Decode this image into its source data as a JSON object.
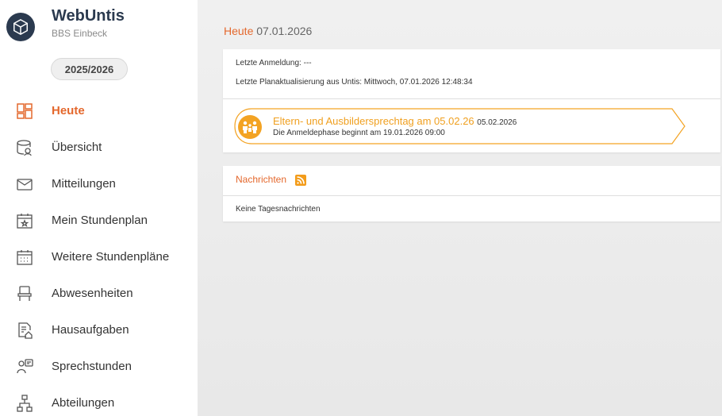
{
  "app": {
    "name": "WebUntis",
    "school": "BBS Einbeck",
    "school_year": "2025/2026"
  },
  "nav": [
    {
      "label": "Heute",
      "icon": "dashboard-icon",
      "active": true
    },
    {
      "label": "Übersicht",
      "icon": "overview-icon",
      "active": false
    },
    {
      "label": "Mitteilungen",
      "icon": "mail-icon",
      "active": false
    },
    {
      "label": "Mein Stundenplan",
      "icon": "my-timetable-icon",
      "active": false
    },
    {
      "label": "Weitere Stundenpläne",
      "icon": "timetables-icon",
      "active": false
    },
    {
      "label": "Abwesenheiten",
      "icon": "absence-icon",
      "active": false
    },
    {
      "label": "Hausaufgaben",
      "icon": "homework-icon",
      "active": false
    },
    {
      "label": "Sprechstunden",
      "icon": "office-hours-icon",
      "active": false
    },
    {
      "label": "Abteilungen",
      "icon": "departments-icon",
      "active": false
    }
  ],
  "header": {
    "title": "Heute",
    "date": "07.01.2026"
  },
  "info": {
    "last_login": "Letzte Anmeldung: ---",
    "last_update": "Letzte Planaktualisierung aus Untis: Mittwoch, 07.01.2026 12:48:34"
  },
  "event": {
    "title": "Eltern- und Ausbildersprechtag am 05.02.26",
    "date": "05.02.2026",
    "subtitle": "Die Anmeldephase beginnt am 19.01.2026 09:00"
  },
  "news": {
    "title": "Nachrichten",
    "empty": "Keine Tagesnachrichten"
  },
  "colors": {
    "accent": "#e4682d",
    "event": "#f3a323",
    "logo_bg": "#2b3a4f"
  }
}
